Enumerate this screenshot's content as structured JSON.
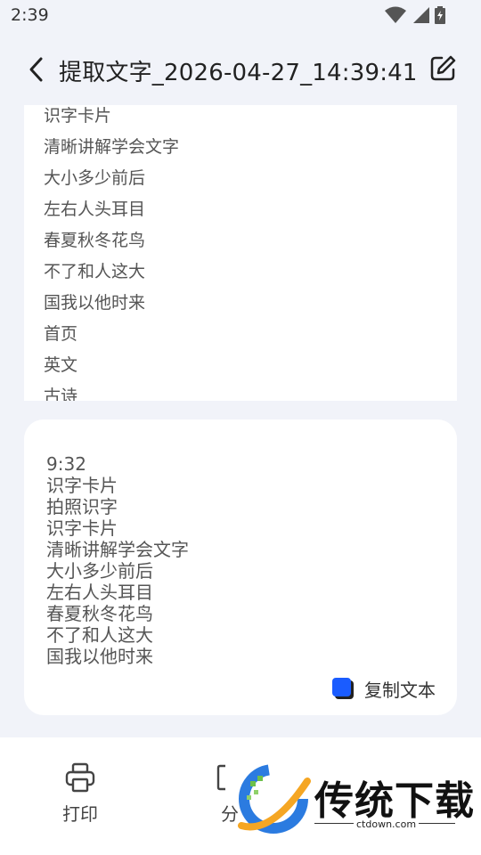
{
  "status_bar": {
    "time": "2:39"
  },
  "header": {
    "title": "提取文字_2026-04-27_14:39:41"
  },
  "preview": {
    "lines": [
      "识字卡片",
      "清晰讲解学会文字",
      "大小多少前后",
      "左右人头耳目",
      "春夏秋冬花鸟",
      "不了和人这大",
      "国我以他时来",
      "首页",
      "英文",
      "古诗"
    ]
  },
  "result": {
    "lines": [
      "9:32",
      "识字卡片",
      "拍照识字",
      "识字卡片",
      "清晰讲解学会文字",
      "大小多少前后",
      "左右人头耳目",
      "春夏秋冬花鸟",
      "不了和人这大",
      "国我以他时来"
    ],
    "copy_label": "复制文本"
  },
  "bottom_bar": {
    "print_label": "打印",
    "second_label_partial": "分"
  },
  "watermark": {
    "brand": "传统下载",
    "url": "ctdown.com"
  },
  "colors": {
    "accent": "#1a5cff",
    "background": "#f1f3f9"
  }
}
